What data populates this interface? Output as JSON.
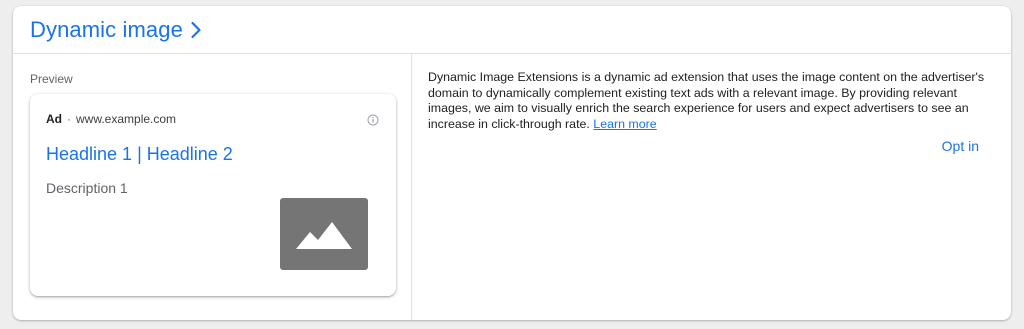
{
  "header": {
    "title": "Dynamic image",
    "chevron_icon": "chevron-right-icon"
  },
  "preview": {
    "label": "Preview",
    "ad": {
      "badge": "Ad",
      "separator": "·",
      "url": "www.example.com",
      "info_icon": "info-icon",
      "headline": "Headline 1 | Headline 2",
      "description": "Description 1",
      "image_icon": "image-placeholder-icon"
    }
  },
  "info": {
    "text": "Dynamic Image Extensions is a dynamic ad extension that uses the image content on the advertiser's domain to dynamically complement existing text ads with a relevant image. By providing relevant images, we aim to visually enrich the search experience for users and expect advertisers to see an increase in click-through rate.",
    "learn_more": "Learn more",
    "opt_in": "Opt in"
  },
  "colors": {
    "accent": "#1a73e8",
    "image_placeholder": "#757575",
    "text_primary": "#202124",
    "text_secondary": "#5f6368"
  }
}
